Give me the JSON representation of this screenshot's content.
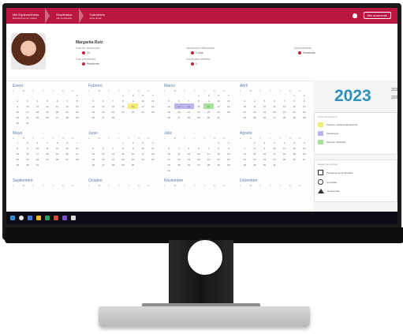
{
  "topbar": {
    "crumbs": [
      {
        "title": "Mis Equipos/Áreas",
        "sub": "Equipo/Área de trabajo"
      },
      {
        "title": "Empleados",
        "sub": "Mis empleados"
      },
      {
        "title": "Calendario",
        "sub": "Vista anual"
      }
    ],
    "button": "Mis ausencias"
  },
  "profile": {
    "name": "Margarita Ruiz",
    "fields": [
      {
        "label": "Días de vacaciones",
        "value": "22"
      },
      {
        "label": "Días pendientes",
        "value": "Pendiente"
      },
      {
        "label": "Vacaciones disfrutadas",
        "value": "2 días"
      },
      {
        "label": "Solicitudes abiertas",
        "value": "1"
      },
      {
        "label": "Departamento",
        "value": "Desarrollo"
      }
    ]
  },
  "calendar": {
    "year": "2023",
    "other_years": [
      "2022",
      "2024"
    ],
    "weekday_headers": [
      "L",
      "M",
      "X",
      "J",
      "V",
      "S",
      "D"
    ],
    "months": [
      {
        "name": "Enero",
        "days": [
          "",
          "",
          "",
          "",
          "",
          "",
          "1",
          "2",
          "3",
          "4",
          "5",
          "6",
          "7",
          "8",
          "9",
          "10",
          "11",
          "12",
          "13",
          "14",
          "15",
          "16",
          "17",
          "18",
          "19",
          "20",
          "21",
          "22",
          "23",
          "24",
          "25",
          "26",
          "27",
          "28",
          "29",
          "30",
          "31"
        ]
      },
      {
        "name": "Febrero",
        "days": [
          "",
          "",
          "",
          "1",
          "2",
          "3",
          "4",
          "5",
          "6",
          "7",
          "8",
          "9",
          "10",
          "11",
          "12",
          "13",
          "14",
          "15",
          "16",
          "17",
          "18",
          "19",
          "20",
          "21",
          "22",
          "23",
          "24",
          "25",
          "26",
          "27",
          "28"
        ]
      },
      {
        "name": "Marzo",
        "days": [
          "",
          "",
          "",
          "1",
          "2",
          "3",
          "4",
          "5",
          "6",
          "7",
          "8",
          "9",
          "10",
          "11",
          "12",
          "13",
          "14",
          "15",
          "16",
          "17",
          "18",
          "19",
          "20",
          "21",
          "22",
          "23",
          "24",
          "25",
          "26",
          "27",
          "28",
          "29",
          "30",
          "31"
        ]
      },
      {
        "name": "Abril",
        "days": [
          "",
          "",
          "",
          "",
          "",
          "1",
          "2",
          "3",
          "4",
          "5",
          "6",
          "7",
          "8",
          "9",
          "10",
          "11",
          "12",
          "13",
          "14",
          "15",
          "16",
          "17",
          "18",
          "19",
          "20",
          "21",
          "22",
          "23",
          "24",
          "25",
          "26",
          "27",
          "28",
          "29",
          "30"
        ]
      },
      {
        "name": "Mayo",
        "days": [
          "1",
          "2",
          "3",
          "4",
          "5",
          "6",
          "7",
          "8",
          "9",
          "10",
          "11",
          "12",
          "13",
          "14",
          "15",
          "16",
          "17",
          "18",
          "19",
          "20",
          "21",
          "22",
          "23",
          "24",
          "25",
          "26",
          "27",
          "28",
          "29",
          "30",
          "31"
        ]
      },
      {
        "name": "Junio",
        "days": [
          "",
          "",
          "",
          "1",
          "2",
          "3",
          "4",
          "5",
          "6",
          "7",
          "8",
          "9",
          "10",
          "11",
          "12",
          "13",
          "14",
          "15",
          "16",
          "17",
          "18",
          "19",
          "20",
          "21",
          "22",
          "23",
          "24",
          "25",
          "26",
          "27",
          "28",
          "29",
          "30"
        ]
      },
      {
        "name": "Julio",
        "days": [
          "",
          "",
          "",
          "",
          "",
          "1",
          "2",
          "3",
          "4",
          "5",
          "6",
          "7",
          "8",
          "9",
          "10",
          "11",
          "12",
          "13",
          "14",
          "15",
          "16",
          "17",
          "18",
          "19",
          "20",
          "21",
          "22",
          "23",
          "24",
          "25",
          "26",
          "27",
          "28",
          "29",
          "30",
          "31"
        ]
      },
      {
        "name": "Agosto",
        "days": [
          "",
          "1",
          "2",
          "3",
          "4",
          "5",
          "6",
          "7",
          "8",
          "9",
          "10",
          "11",
          "12",
          "13",
          "14",
          "15",
          "16",
          "17",
          "18",
          "19",
          "20",
          "21",
          "22",
          "23",
          "24",
          "25",
          "26",
          "27",
          "28",
          "29",
          "30",
          "31"
        ]
      },
      {
        "name": "Septiembre",
        "days": []
      },
      {
        "name": "Octubre",
        "days": []
      },
      {
        "name": "Noviembre",
        "days": []
      },
      {
        "name": "Diciembre",
        "days": []
      }
    ],
    "highlights": [
      {
        "month": 1,
        "day": "16",
        "type": "yellow"
      },
      {
        "month": 2,
        "day": "13",
        "type": "blue"
      },
      {
        "month": 2,
        "day": "14",
        "type": "blue"
      },
      {
        "month": 2,
        "day": "16",
        "type": "green"
      }
    ]
  },
  "legend": {
    "title": "Tipos de ausencia",
    "items": [
      {
        "label": "Festivo o fiesta local/nacional",
        "color": "#f4ec7a"
      },
      {
        "label": "Vacaciones",
        "color": "#b9b3f0"
      },
      {
        "label": "Permiso retribuido",
        "color": "#a6e39a"
      }
    ]
  },
  "symbols": {
    "title": "Estado de solicitud",
    "items": [
      {
        "label": "Pendiente de aprobación"
      },
      {
        "label": "Aprobada"
      },
      {
        "label": "Rechazada"
      }
    ]
  },
  "colors": {
    "brand": "#b9173f",
    "year": "#2f8fb8",
    "month_title": "#5a7fa8"
  }
}
